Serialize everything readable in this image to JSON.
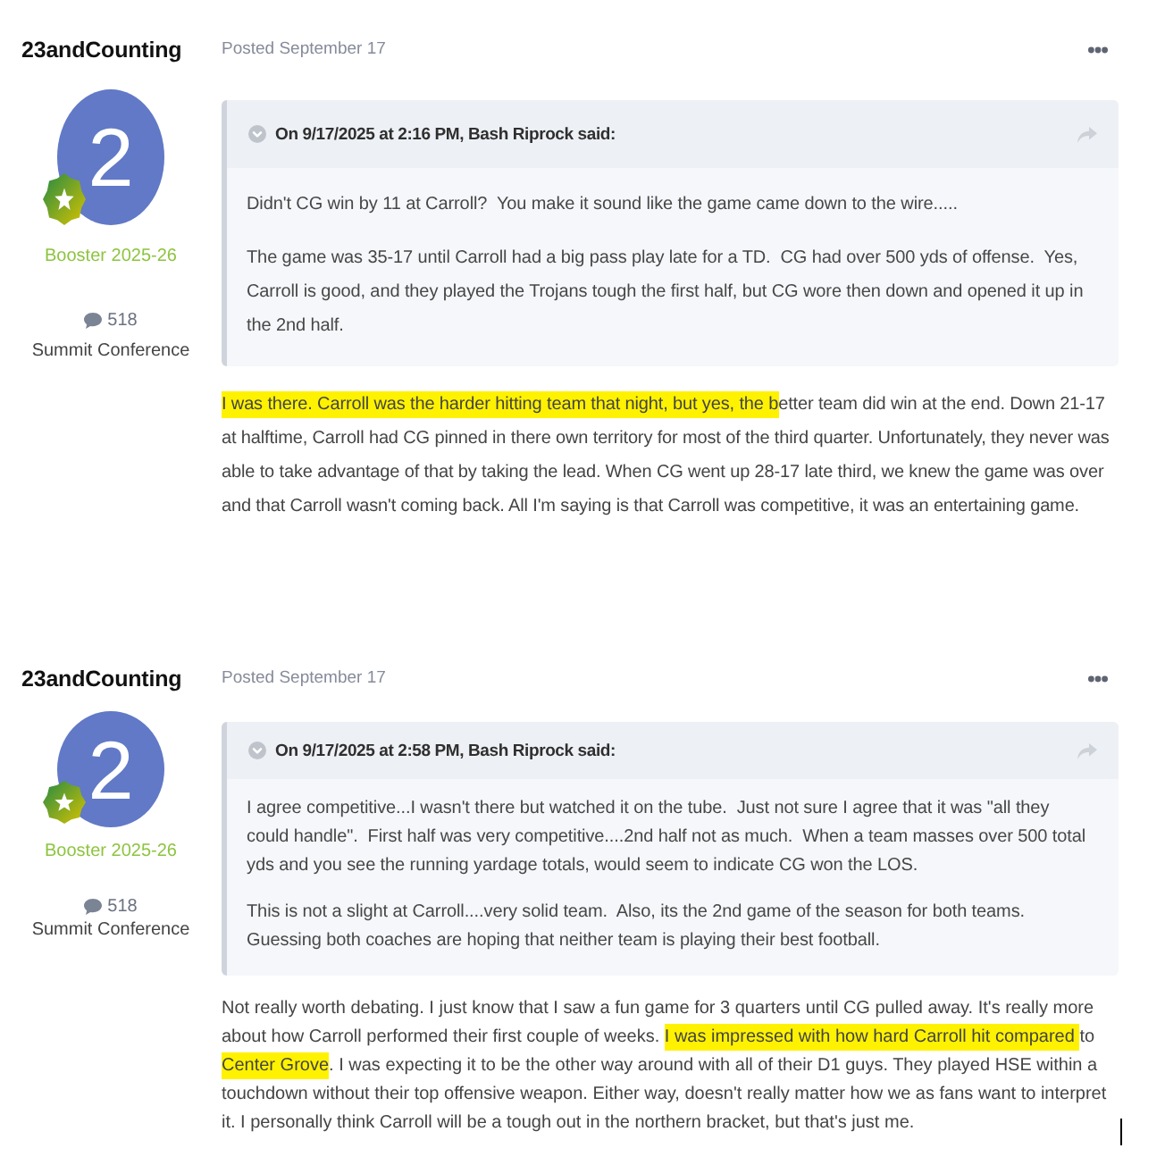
{
  "posts": [
    {
      "author": {
        "name": "23andCounting",
        "avatar_letter": "2",
        "rank": "Booster 2025-26",
        "post_count": "518",
        "group": "Summit Conference"
      },
      "date": "Posted September 17",
      "quote": {
        "attribution": "On 9/17/2025 at 2:16 PM, Bash Riprock said:",
        "paragraphs": [
          "Didn't CG win by 11 at Carroll?  You make it sound like the game came down to the wire.....",
          "The game was 35-17 until Carroll had a big pass play late for a TD.  CG had over 500 yds of offense.  Yes, Carroll is good, and they played the Trojans tough the first half, but CG wore then down and opened it up in the 2nd half."
        ]
      },
      "body": [
        {
          "text": "I was there. Carroll was the harder hitting team that night, but yes, the b",
          "highlighted": true
        },
        {
          "text": "etter team did win at the end. Down 21-17 at halftime, Carroll had CG pinned in there own territory for most of the third quarter. Unfortunately, they never was able to take advantage of that by taking the lead. When CG went up 28-17 late third, we knew the game was over and that Carroll wasn't coming back. All I'm saying is that Carroll was competitive, it was an entertaining game.",
          "highlighted": false
        }
      ]
    },
    {
      "author": {
        "name": "23andCounting",
        "avatar_letter": "2",
        "rank": "Booster 2025-26",
        "post_count": "518",
        "group": "Summit Conference"
      },
      "date": "Posted September 17",
      "quote": {
        "attribution": "On 9/17/2025 at 2:58 PM, Bash Riprock said:",
        "paragraphs": [
          "I agree competitive...I wasn't there but watched it on the tube.  Just not sure I agree that it was \"all they could handle\".  First half was very competitive....2nd half not as much.  When a team masses over 500 total yds and you see the running yardage totals, would seem to indicate CG won the LOS.",
          "This is not a slight at Carroll....very solid team.  Also, its the 2nd game of the season for both teams.  Guessing both coaches are hoping that neither team is playing their best football."
        ]
      },
      "body": [
        {
          "text": "Not really worth debating. I just know that I saw a fun game for 3 quarters until CG pulled away. It's really more about how Carroll performed their first couple of weeks. ",
          "highlighted": false
        },
        {
          "text": "I was impressed with how hard Carroll hit compared ",
          "highlighted": true
        },
        {
          "text": "to ",
          "highlighted": false
        },
        {
          "text": "Center Grove",
          "highlighted": true
        },
        {
          "text": ". I was expecting it to be the other way around with all of their D1 guys. They played HSE within a touchdown without their top offensive weapon. Either way, doesn't really matter how we as fans want to interpret it. I personally think Carroll will be a tough out in the northern bracket, but that's just me.",
          "highlighted": false
        }
      ]
    }
  ]
}
